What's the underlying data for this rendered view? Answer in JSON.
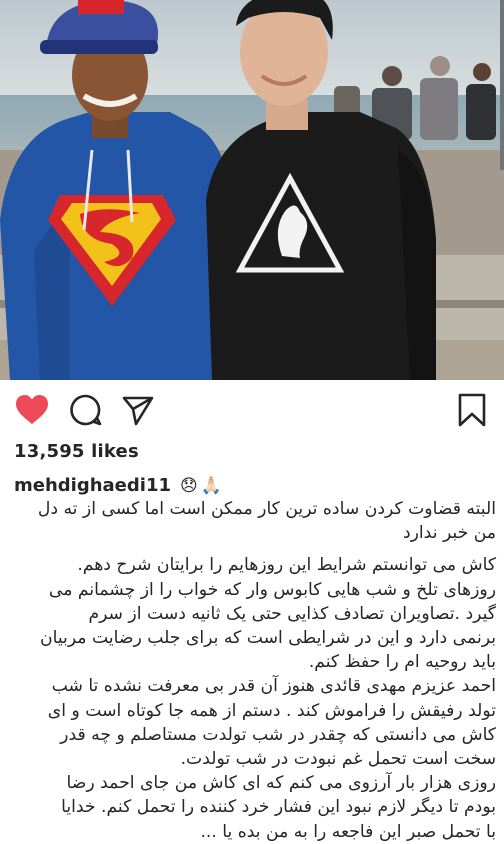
{
  "post": {
    "likes_text": "13,595 likes",
    "username": "mehdighaedi11",
    "header_emojis": [
      "😞",
      "🙏🏻"
    ],
    "caption_lines": [
      "البته قضاوت کردن ساده ترین کار ممکن است اما کسی از ته دل",
      "من خبر ندارد",
      "کاش می  توانستم شرایط این روزهایم را برایتان شرح دهم.",
      "روزهای تلخ و شب هایی کابوس وار  که خواب را از چشمانم می",
      "گیرد .تصاویران  تصادف کذایی حتی یک ثانیه دست از سرم",
      "برنمی دارد و این در شرایطی است که برای جلب رضایت مربیان",
      "باید روحیه ام را حفظ کنم.",
      "احمد عزیزم مهدی قائدی هنوز آن قدر بی معرفت نشده  تا  شب",
      "تولد رفیقش را فراموش کند . دستم از  همه جا کوتاه است و ای",
      "کاش می دانستی که چقدر در شب تولدت مستاصلم و چه قدر",
      "سخت است  تحمل غم نبودت در شب تولدت.",
      "روزی هزار بار آرزوی می کنم که ای کاش من جای احمد رضا",
      "بودم تا دیگر لازم نبود این فشار خرد کننده  را تحمل کنم. خدایا",
      "با تحمل صبر این فاجعه را به من بده یا ..."
    ]
  },
  "icons": {
    "like": "heart-icon",
    "comment": "comment-icon",
    "share": "send-icon",
    "save": "bookmark-icon"
  },
  "colors": {
    "like_active": "#ed4956",
    "text": "#262626"
  }
}
